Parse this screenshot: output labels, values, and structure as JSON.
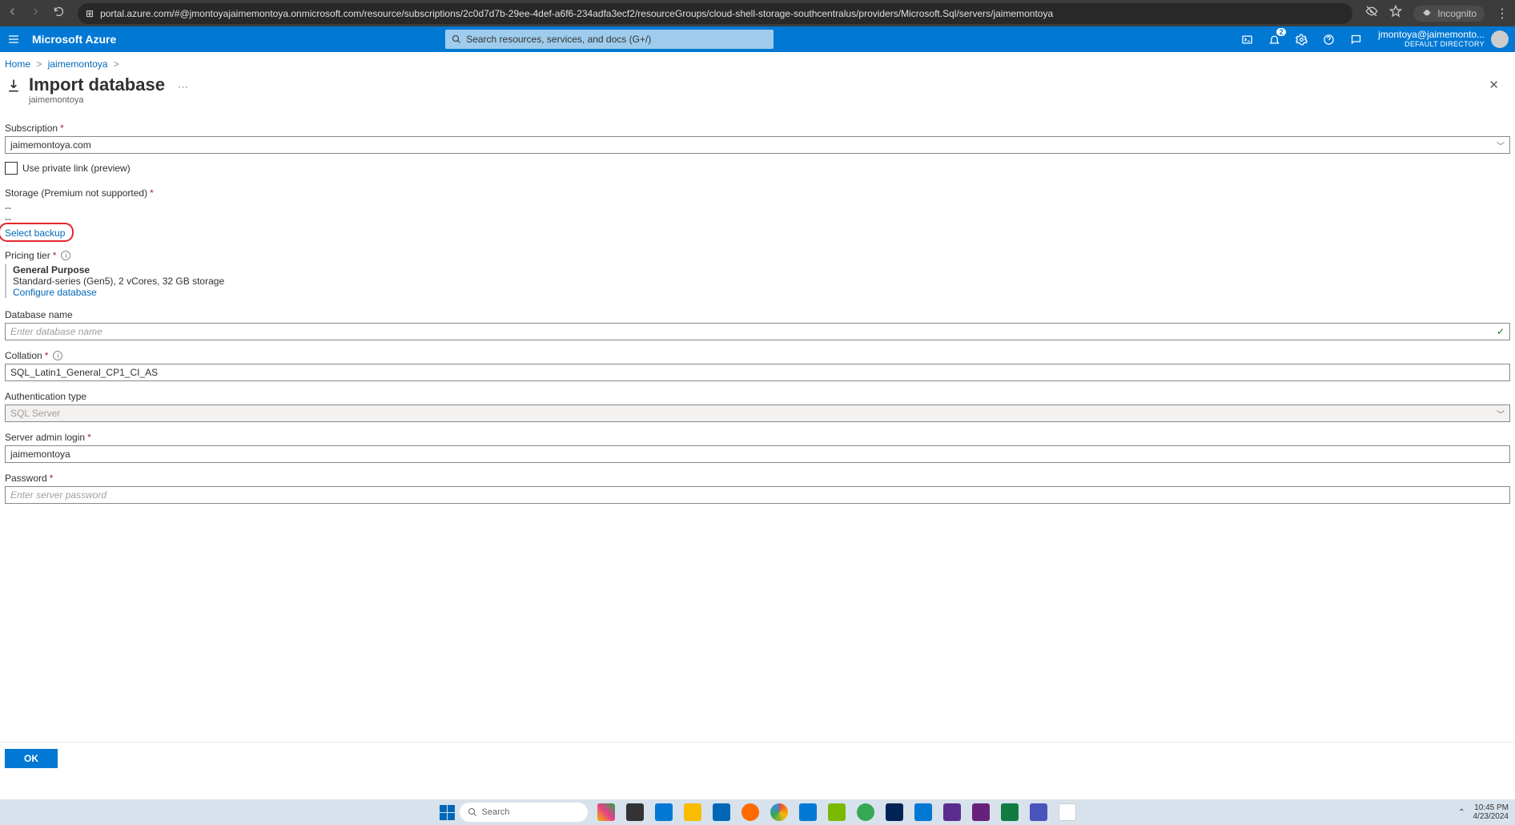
{
  "browser": {
    "url": "portal.azure.com/#@jmontoyajaimemontoya.onmicrosoft.com/resource/subscriptions/2c0d7d7b-29ee-4def-a6f6-234adfa3ecf2/resourceGroups/cloud-shell-storage-southcentralus/providers/Microsoft.Sql/servers/jaimemontoya",
    "incognito": "Incognito"
  },
  "topbar": {
    "brand": "Microsoft Azure",
    "search_placeholder": "Search resources, services, and docs (G+/)",
    "notif_count": "2",
    "account_email": "jmontoya@jaimemonto...",
    "account_dir": "DEFAULT DIRECTORY"
  },
  "breadcrumb": {
    "home": "Home",
    "server": "jaimemontoya"
  },
  "page": {
    "title": "Import database",
    "subtitle": "jaimemontoya"
  },
  "form": {
    "subscription_label": "Subscription",
    "subscription_value": "jaimemontoya.com",
    "private_link_label": "Use private link (preview)",
    "storage_label": "Storage (Premium not supported)",
    "storage_val1": "--",
    "storage_val2": "--",
    "select_backup": "Select backup",
    "pricing_label": "Pricing tier",
    "pricing_tier": "General Purpose",
    "pricing_desc": "Standard-series (Gen5), 2 vCores, 32 GB storage",
    "configure_db": "Configure database",
    "db_name_label": "Database name",
    "db_name_placeholder": "Enter database name",
    "collation_label": "Collation",
    "collation_value": "SQL_Latin1_General_CP1_CI_AS",
    "auth_label": "Authentication type",
    "auth_value": "SQL Server",
    "admin_label": "Server admin login",
    "admin_value": "jaimemontoya",
    "password_label": "Password",
    "password_placeholder": "Enter server password",
    "ok": "OK"
  },
  "taskbar": {
    "search": "Search",
    "time": "10:45 PM",
    "date": "4/23/2024"
  }
}
